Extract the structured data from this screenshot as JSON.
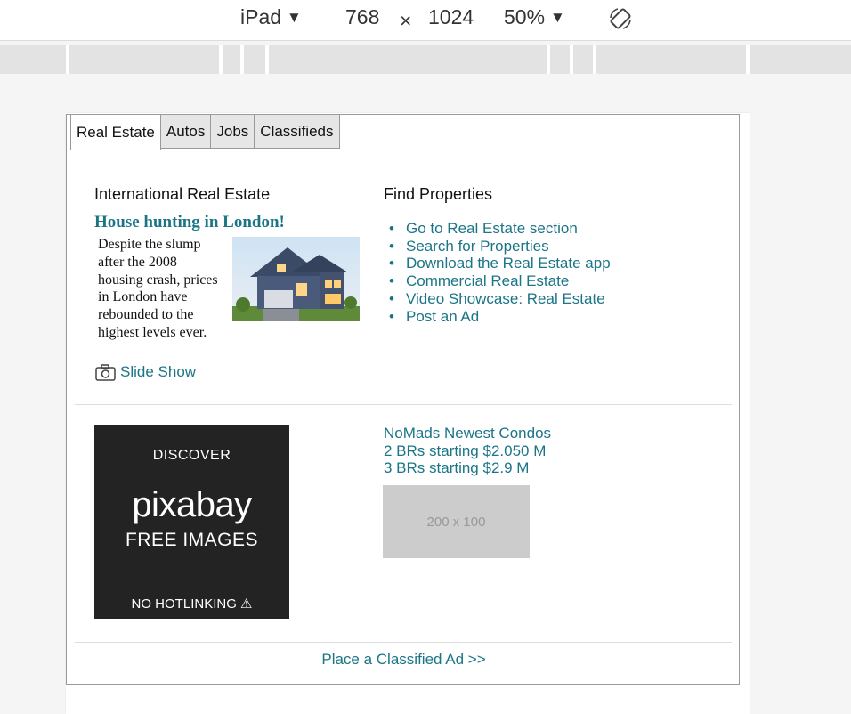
{
  "device_toolbar": {
    "device": "iPad",
    "width": "768",
    "times": "×",
    "height": "1024",
    "zoom": "50%",
    "dropdown_glyph": "▼"
  },
  "tabs": [
    "Real Estate",
    "Autos",
    "Jobs",
    "Classifieds"
  ],
  "active_tab": "Real Estate",
  "left_section": {
    "heading": "International Real Estate",
    "feature_title": "House hunting in London!",
    "feature_text": "Despite the slump after the 2008 housing crash, prices in London have rebounded to the highest levels ever.",
    "slideshow_label": "Slide Show"
  },
  "right_section": {
    "heading": "Find Properties",
    "links": [
      "Go to Real Estate section",
      "Search for Properties",
      "Download the Real Estate app",
      "Commercial Real Estate",
      "Video Showcase: Real Estate",
      "Post an Ad"
    ]
  },
  "ad": {
    "discover": "DISCOVER",
    "logo": "pixabay",
    "free_images": "FREE IMAGES",
    "no_hotlinking": "NO HOTLINKING ⚠"
  },
  "condo": {
    "title": "NoMads Newest Condos",
    "line1": "2 BRs starting $2.050 M",
    "line2": "3 BRs starting $2.9 M",
    "placeholder": "200 x 100"
  },
  "footer_link": "Place a Classified Ad >>",
  "colors": {
    "link": "#1b7587",
    "border": "#9a9a9a"
  }
}
